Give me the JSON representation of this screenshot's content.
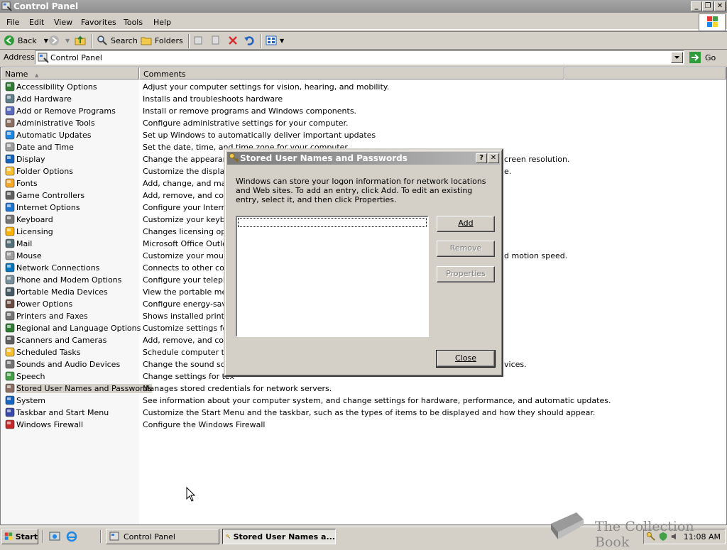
{
  "window": {
    "title": "Control Panel",
    "buttons": [
      "_",
      "❐",
      "✕"
    ]
  },
  "menubar": {
    "items": [
      {
        "label": "File"
      },
      {
        "label": "Edit"
      },
      {
        "label": "View"
      },
      {
        "label": "Favorites"
      },
      {
        "label": "Tools"
      },
      {
        "label": "Help"
      }
    ]
  },
  "toolbar": {
    "back": "Back",
    "search": "Search",
    "folders": "Folders"
  },
  "address": {
    "label": "Address",
    "value": "Control Panel",
    "go": "Go"
  },
  "listview": {
    "columns": {
      "name": "Name",
      "comments": "Comments"
    },
    "rows": [
      {
        "name": "Accessibility Options",
        "comment": "Adjust your computer settings for vision, hearing, and mobility.",
        "icon": "accessibility-icon",
        "color": "#2e7d32"
      },
      {
        "name": "Add Hardware",
        "comment": "Installs and troubleshoots hardware",
        "icon": "add-hardware-icon",
        "color": "#607d8b"
      },
      {
        "name": "Add or Remove Programs",
        "comment": "Install or remove programs and Windows components.",
        "icon": "add-remove-programs-icon",
        "color": "#5c6bc0"
      },
      {
        "name": "Administrative Tools",
        "comment": "Configure administrative settings for your computer.",
        "icon": "admin-tools-icon",
        "color": "#8d6e63"
      },
      {
        "name": "Automatic Updates",
        "comment": "Set up Windows to automatically deliver important updates",
        "icon": "automatic-updates-icon",
        "color": "#1e88e5"
      },
      {
        "name": "Date and Time",
        "comment": "Set the date, time, and time zone for your computer.",
        "icon": "clock-icon",
        "color": "#9e9e9e"
      },
      {
        "name": "Display",
        "comment": "Change the appearance",
        "comment_tail": "creen resolution.",
        "icon": "display-icon",
        "color": "#1565c0"
      },
      {
        "name": "Folder Options",
        "comment": "Customize the display o",
        "comment_tail": "e.",
        "icon": "folder-options-icon",
        "color": "#fbc02d"
      },
      {
        "name": "Fonts",
        "comment": "Add, change, and mana",
        "icon": "fonts-icon",
        "color": "#f9a825"
      },
      {
        "name": "Game Controllers",
        "comment": "Add, remove, and confi",
        "icon": "game-controller-icon",
        "color": "#616161"
      },
      {
        "name": "Internet Options",
        "comment": "Configure your Internet",
        "icon": "internet-options-icon",
        "color": "#1976d2"
      },
      {
        "name": "Keyboard",
        "comment": "Customize your keyboa",
        "icon": "keyboard-icon",
        "color": "#757575"
      },
      {
        "name": "Licensing",
        "comment": "Changes licensing optior",
        "icon": "licensing-icon",
        "color": "#ffb300"
      },
      {
        "name": "Mail",
        "comment": "Microsoft Office Outlook",
        "icon": "mail-icon",
        "color": "#546e7a"
      },
      {
        "name": "Mouse",
        "comment": "Customize your mouse s",
        "comment_tail": "d motion speed.",
        "icon": "mouse-icon",
        "color": "#9e9e9e"
      },
      {
        "name": "Network Connections",
        "comment": "Connects to other comp",
        "icon": "network-connections-icon",
        "color": "#0277bd"
      },
      {
        "name": "Phone and Modem Options",
        "comment": "Configure your telephor",
        "icon": "phone-modem-icon",
        "color": "#78909c"
      },
      {
        "name": "Portable Media Devices",
        "comment": "View the portable media",
        "icon": "portable-media-icon",
        "color": "#455a64"
      },
      {
        "name": "Power Options",
        "comment": "Configure energy-savin",
        "icon": "power-options-icon",
        "color": "#6d4c41"
      },
      {
        "name": "Printers and Faxes",
        "comment": "Shows installed printers",
        "icon": "printer-icon",
        "color": "#757575"
      },
      {
        "name": "Regional and Language Options",
        "comment": "Customize settings for t",
        "icon": "globe-icon",
        "color": "#2e7d32"
      },
      {
        "name": "Scanners and Cameras",
        "comment": "Add, remove, and confi",
        "icon": "scanner-icon",
        "color": "#616161"
      },
      {
        "name": "Scheduled Tasks",
        "comment": "Schedule computer task",
        "icon": "scheduled-tasks-icon",
        "color": "#fbc02d"
      },
      {
        "name": "Sounds and Audio Devices",
        "comment": "Change the sound sche",
        "comment_tail": "vices.",
        "icon": "speaker-icon",
        "color": "#757575"
      },
      {
        "name": "Speech",
        "comment": "Change settings for tex",
        "icon": "speech-icon",
        "color": "#43a047"
      },
      {
        "name": "Stored User Names and Passwords",
        "comment": "Manages stored credentials for network servers.",
        "icon": "key-icon",
        "color": "#8d6e63",
        "selected": true
      },
      {
        "name": "System",
        "comment": "See information about your computer system, and change settings for hardware, performance, and automatic updates.",
        "icon": "system-icon",
        "color": "#1565c0"
      },
      {
        "name": "Taskbar and Start Menu",
        "comment": "Customize the Start Menu and the taskbar, such as the types of items to be displayed and how they should appear.",
        "icon": "taskbar-icon",
        "color": "#3949ab"
      },
      {
        "name": "Windows Firewall",
        "comment": "Configure the Windows Firewall",
        "icon": "firewall-icon",
        "color": "#c62828"
      }
    ]
  },
  "dialog": {
    "title": "Stored User Names and Passwords",
    "help_btn": "?",
    "close_x": "✕",
    "text": "Windows can store your logon information for network locations and Web sites. To add an entry, click Add. To edit an existing entry, select it, and then click Properties.",
    "buttons": {
      "add": "Add",
      "remove": "Remove",
      "properties": "Properties",
      "close": "Close"
    }
  },
  "taskbar": {
    "start": "Start",
    "tasks": [
      {
        "label": "Control Panel",
        "active": false
      },
      {
        "label": "Stored User Names a...",
        "active": true
      }
    ],
    "clock": "11:08 AM"
  },
  "watermark": "The Collection Book"
}
